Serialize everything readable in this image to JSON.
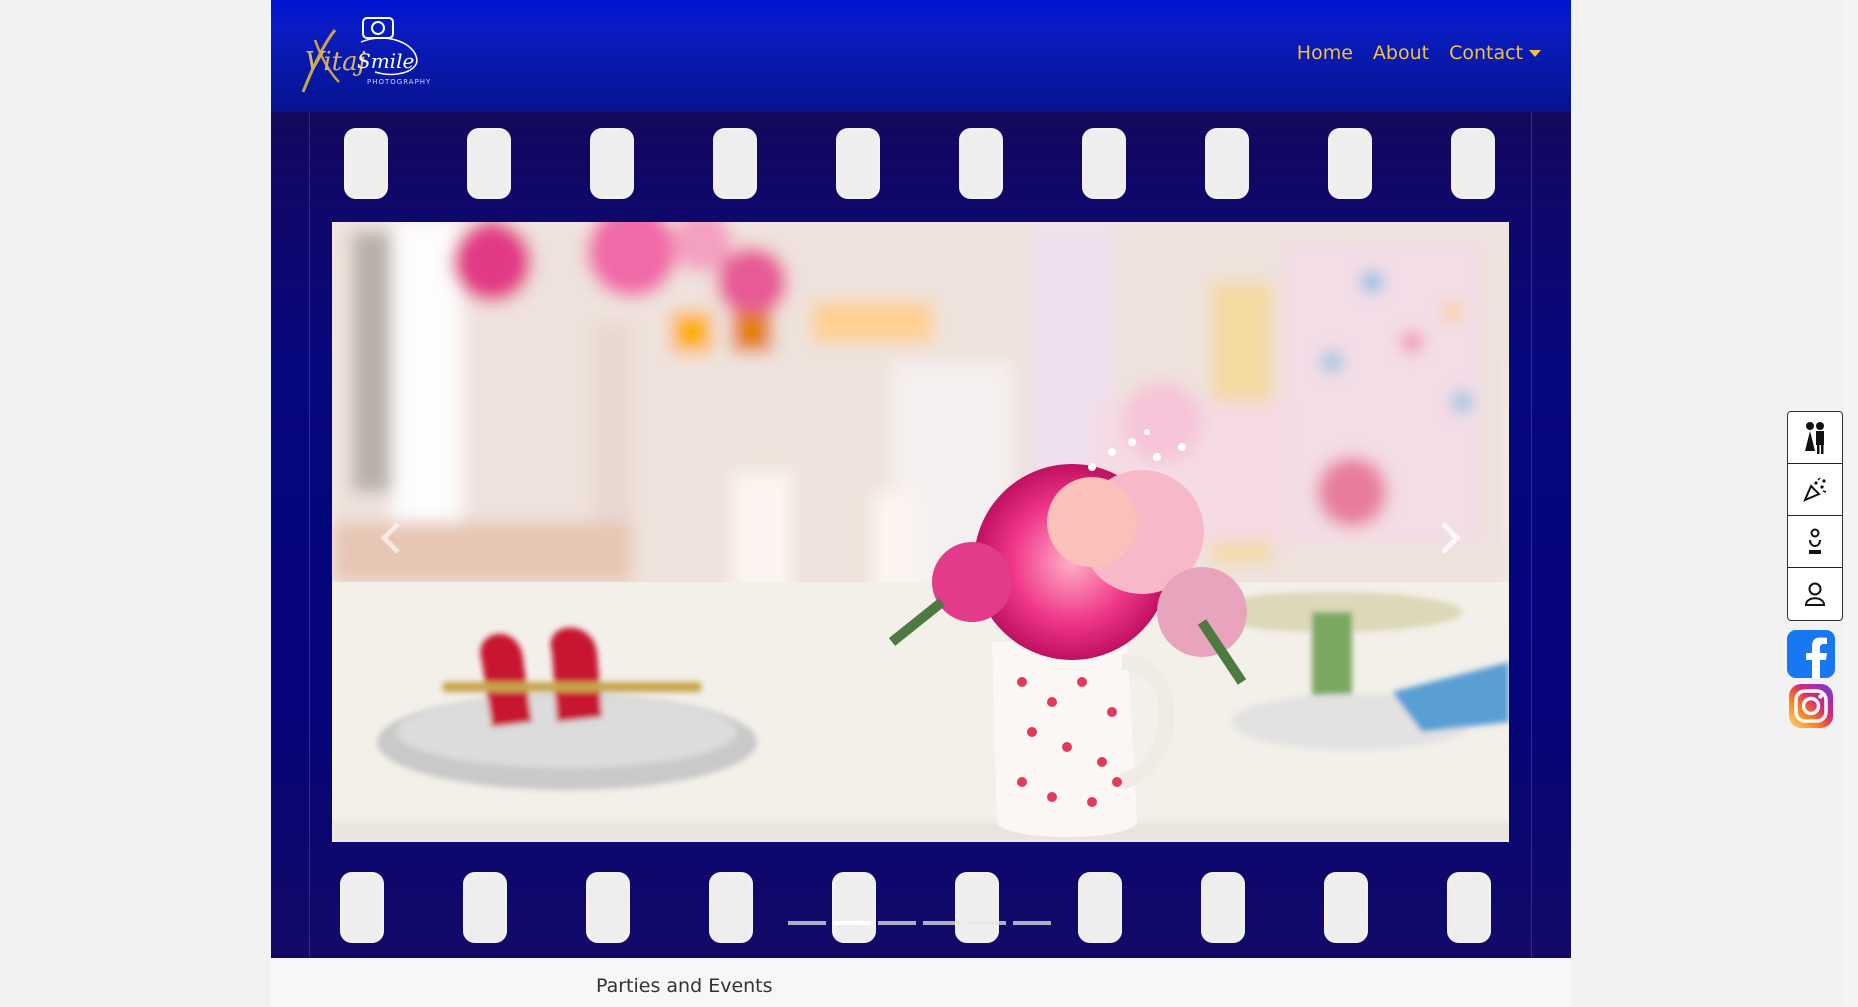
{
  "brand": {
    "logo_script": "Vitaj Smile",
    "logo_sub": "PHOTOGRAPHY"
  },
  "nav": {
    "items": [
      {
        "label": "Home"
      },
      {
        "label": "About"
      },
      {
        "label": "Contact",
        "has_dropdown": true
      }
    ]
  },
  "carousel": {
    "slide_count": 6,
    "active_index": 1,
    "prev_icon": "chevron-left-icon",
    "next_icon": "chevron-right-icon"
  },
  "caption": "Parties and Events",
  "side_menu": {
    "items": [
      {
        "icon": "wedding-couple-icon"
      },
      {
        "icon": "party-popper-icon"
      },
      {
        "icon": "baptism-icon"
      },
      {
        "icon": "portrait-icon"
      }
    ]
  },
  "social": [
    {
      "icon": "facebook-icon",
      "color": "#1877f2"
    },
    {
      "icon": "instagram-icon",
      "color": "#e1306c"
    }
  ],
  "colors": {
    "navbar": "#0a1cc2",
    "nav_text": "#f0c040",
    "film": "#05047a"
  }
}
